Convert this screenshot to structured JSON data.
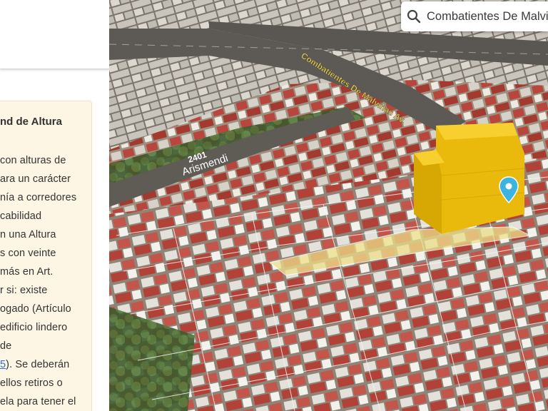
{
  "side_panel": {
    "info_title": "nd de Altura",
    "info_lines": [
      "con alturas de",
      "ara un carácter",
      "nía a corredores",
      "cabilidad",
      "n una Altura",
      "s con veinte",
      "más en Art.",
      "r si: existe",
      "ogado (Artículo",
      "edificio lindero",
      "de"
    ],
    "link_line": {
      "link": "5",
      "rest": "). Se deberán"
    },
    "tail_lines": [
      "ellos retiros o",
      "ela para tener el"
    ]
  },
  "map": {
    "search": {
      "value": "Combatientes De Malvinas"
    },
    "streets": {
      "main": "Combatientes De Malvinas Av.",
      "cross_number": "2401",
      "cross_name": "Arismendi"
    },
    "colors": {
      "building_volume": "#f2c200",
      "lot_highlight": "#efe08a",
      "pin": "#3cb4e0"
    },
    "pin_icon": "location-pin-icon"
  }
}
